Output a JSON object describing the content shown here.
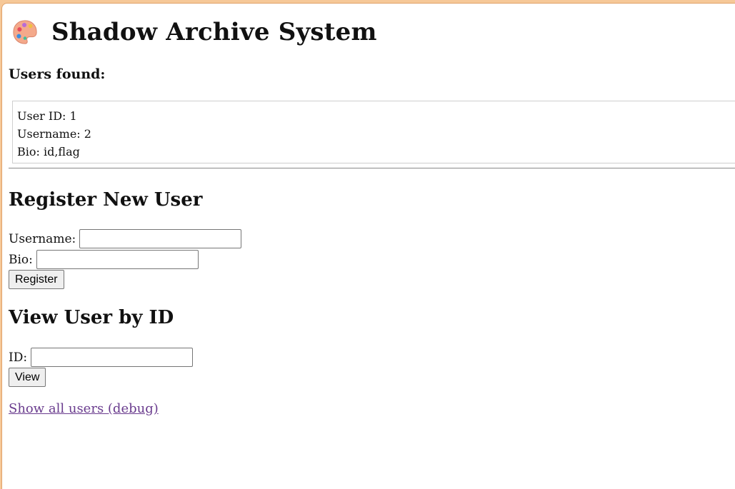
{
  "header": {
    "title": "Shadow Archive System",
    "logo_icon": "palette-icon"
  },
  "results": {
    "heading": "Users found:",
    "user_id": "User ID: 1",
    "username": "Username: 2",
    "bio": "Bio: id,flag"
  },
  "register": {
    "heading": "Register New User",
    "username_label": "Username:",
    "username_value": "",
    "bio_label": "Bio:",
    "bio_value": "",
    "button_label": "Register"
  },
  "view": {
    "heading": "View User by ID",
    "id_label": "ID:",
    "id_value": "",
    "button_label": "View"
  },
  "debug_link": "Show all users (debug)",
  "colors": {
    "browser_frame": "#f6c898",
    "link_visited": "#6a3c8e"
  }
}
